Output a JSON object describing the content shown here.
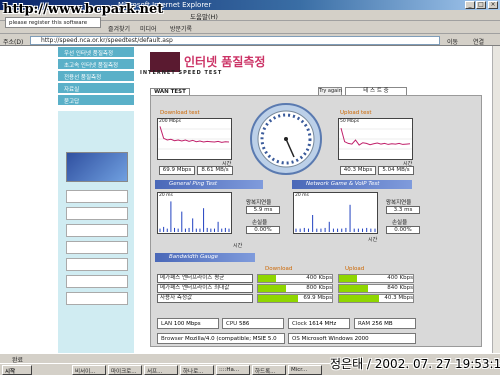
{
  "window": {
    "title": "Microsoft Internet Explorer",
    "watermark": "http://www.bcpark.net",
    "tooltip": "please register this software"
  },
  "menu": {
    "help": "도움말(H)"
  },
  "toolbar": {
    "favorites": "즐겨찾기",
    "media": "미디어",
    "history": "방문기록"
  },
  "address": {
    "label": "주소(D)",
    "url": "http://speed.nca.or.kr/speedtest/default.asp",
    "go": "이동",
    "links": "연결"
  },
  "nav": {
    "items": [
      "우선 인터넷 품질측정",
      "초고속 인터넷 품질측정",
      "전용선 품질측정",
      "자료실",
      "묻고답"
    ]
  },
  "header": {
    "title": "인터넷 품질측정",
    "subtitle": "INTERNET SPEED TEST"
  },
  "wan": {
    "tab": "WAN TEST",
    "try_again": "Try again",
    "status_title": "테 스 트 중"
  },
  "download": {
    "title": "Download test",
    "axis_top": "200 Mbps",
    "time_label": "시간",
    "value1": "69.9 Mbps",
    "value2": "8.61 MB/s",
    "samples": [
      0.9,
      0.55,
      0.5,
      0.52,
      0.48,
      0.5,
      0.47,
      0.5,
      0.46,
      0.49,
      0.45,
      0.47,
      0.44,
      0.46,
      0.45,
      0.44,
      0.46,
      0.43,
      0.45,
      0.44
    ]
  },
  "upload": {
    "title": "Upload test",
    "axis_top": "50 Mbps",
    "time_label": "시간",
    "value1": "40.3 Mbps",
    "value2": "5.04 MB/s",
    "samples": [
      0.85,
      0.45,
      0.4,
      0.38,
      0.5,
      0.35,
      0.42,
      0.4,
      0.36,
      0.39,
      0.41,
      0.38,
      0.4,
      0.37,
      0.39,
      0.38,
      0.4,
      0.37,
      0.38,
      0.39
    ]
  },
  "ping": {
    "title": "General Ping Test",
    "axis_top": "20 ms",
    "time_label": "시간",
    "latency_label": "왕복지연율",
    "latency_value": "5.9 ms",
    "loss_label": "손실율",
    "loss_value": "0.00%",
    "samples": [
      0.1,
      0.15,
      0.1,
      0.9,
      0.12,
      0.1,
      0.6,
      0.1,
      0.12,
      0.4,
      0.1,
      0.1,
      0.7,
      0.12,
      0.1,
      0.1,
      0.3,
      0.1,
      0.12,
      0.1
    ]
  },
  "game": {
    "title": "Network Game & VoIP Test",
    "axis_top": "20 ms",
    "time_label": "시간",
    "latency_label": "왕복지연율",
    "latency_value": "3.3 ms",
    "loss_label": "손실율",
    "loss_value": "0.00%",
    "samples": [
      0.1,
      0.1,
      0.12,
      0.1,
      0.5,
      0.1,
      0.1,
      0.12,
      0.3,
      0.1,
      0.1,
      0.1,
      0.12,
      0.8,
      0.1,
      0.1,
      0.1,
      0.12,
      0.1,
      0.1
    ]
  },
  "gauge": {
    "title": "Bandwidth Gauge",
    "download_header": "Download",
    "upload_header": "Upload",
    "rows": [
      {
        "label": "메가패스 엔터프라이즈 평균",
        "down": "400 Kbps",
        "down_fill": 0.45,
        "up": "400 Kbps",
        "up_fill": 0.45
      },
      {
        "label": "메가패스 엔터프라이즈 최대값",
        "down": "800 Kbps",
        "down_fill": 0.7,
        "up": "840 Kbps",
        "up_fill": 0.72
      },
      {
        "label": "사용자 측정값",
        "down": "69.9 Mbps",
        "down_fill": 1.0,
        "up": "40.3 Mbps",
        "up_fill": 1.0
      }
    ]
  },
  "sysinfo": {
    "lan_label": "LAN",
    "lan": "100 Mbps",
    "cpu_label": "CPU",
    "cpu": "586",
    "clock_label": "Clock",
    "clock": "1614 MHz",
    "ram_label": "RAM",
    "ram": "256 MB",
    "browser_label": "Browser",
    "browser": "Mozilla/4.0 (compatible; MSIE 5.0",
    "os_label": "OS",
    "os": "Microsoft Windows 2000"
  },
  "statusbar": {
    "text": "완료"
  },
  "taskbar": {
    "start": "시작",
    "items": [
      "비서이...",
      "마이크로...",
      "서프...",
      "하나로...",
      "::::Ha...",
      "하드록...",
      "Micr..."
    ]
  },
  "signature": "정은태 / 2002. 07. 27 19:53:12",
  "colors": {
    "nav": "#5ab0c8",
    "section": "#4a68b8",
    "gauge_bar": "#8fd600",
    "title_accent": "#cc3366"
  }
}
